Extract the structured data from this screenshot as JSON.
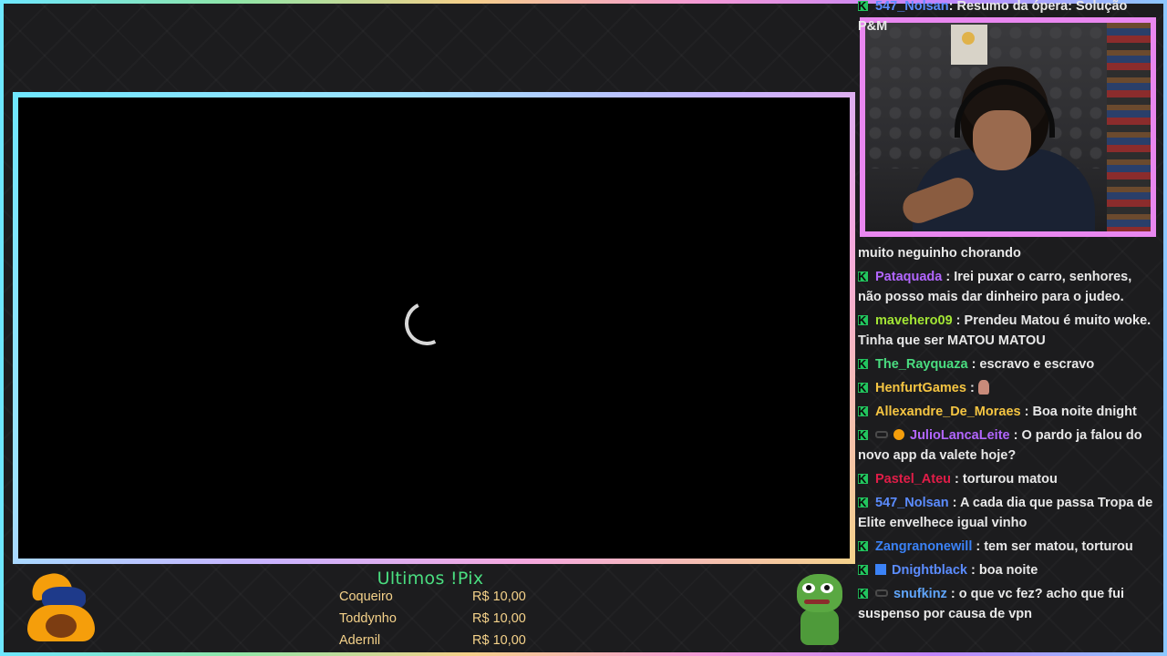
{
  "pix": {
    "title": "Ultimos !Pix",
    "entries": [
      {
        "name": "Coqueiro",
        "value": "R$ 10,00"
      },
      {
        "name": "Toddynho",
        "value": "R$ 10,00"
      },
      {
        "name": "Adernil",
        "value": "R$ 10,00"
      }
    ]
  },
  "chat": {
    "messages": [
      {
        "user": "547_Nolsan",
        "color": "#5b8cff",
        "text": ": Resumo da ópera: Solução P&M"
      },
      {
        "user": "",
        "color": "#e8e8e8",
        "text": "muito neguinho chorando"
      },
      {
        "user": "Pataquada",
        "color": "#b266ff",
        "text": ": Irei puxar o carro, senhores, não posso mais dar dinheiro para o judeo."
      },
      {
        "user": "mavehero09",
        "color": "#a3e635",
        "text": ": Prendeu Matou é muito woke. Tinha que ser MATOU MATOU"
      },
      {
        "user": "The_Rayquaza",
        "color": "#4ade80",
        "text": ": escravo e escravo"
      },
      {
        "user": "HenfurtGames",
        "color": "#f5c542",
        "text": ":"
      },
      {
        "user": "Allexandre_De_Moraes",
        "color": "#f5c542",
        "text": ": Boa noite dnight"
      },
      {
        "user": "JulioLancaLeite",
        "color": "#b266ff",
        "text": ": O pardo ja falou do novo app da valete hoje?"
      },
      {
        "user": "Pastel_Ateu",
        "color": "#e11d48",
        "text": ": torturou matou"
      },
      {
        "user": "547_Nolsan",
        "color": "#5b8cff",
        "text": ": A cada dia que passa Tropa de Elite envelhece igual vinho"
      },
      {
        "user": "Zangranonewill",
        "color": "#3b82f6",
        "text": ": tem ser matou, torturou"
      },
      {
        "user": "Dnightblack",
        "color": "#5b8cff",
        "text": ": boa noite"
      },
      {
        "user": "snufkinz",
        "color": "#60a5fa",
        "text": ": o que vc fez? acho que fui suspenso por causa de vpn"
      }
    ]
  }
}
